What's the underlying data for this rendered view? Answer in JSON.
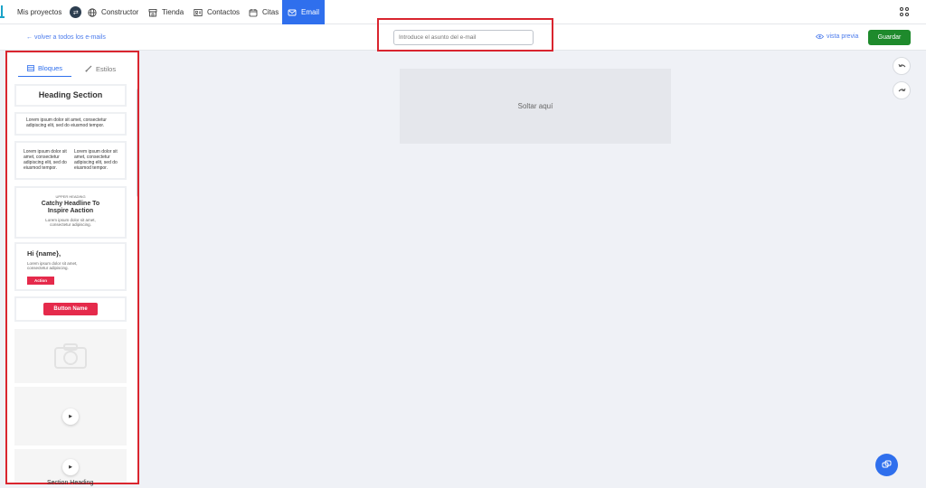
{
  "nav": {
    "projects_label": "Mis proyectos",
    "items": [
      {
        "label": "Constructor",
        "icon": "globe-icon"
      },
      {
        "label": "Tienda",
        "icon": "store-icon"
      },
      {
        "label": "Contactos",
        "icon": "contacts-icon"
      },
      {
        "label": "Citas",
        "icon": "calendar-icon"
      },
      {
        "label": "Email",
        "icon": "mail-icon",
        "active": true
      }
    ],
    "active_color": "#2f6fed"
  },
  "subbar": {
    "back_label": "← volver a todos los e-mails",
    "subject_placeholder": "Introduce el asunto del e-mail",
    "preview_label": "vista previa",
    "save_label": "Guardar"
  },
  "sidebar": {
    "tabs": [
      {
        "label": "Bloques",
        "active": true
      },
      {
        "label": "Estilos"
      }
    ],
    "blocks": {
      "heading": "Heading Section",
      "text": "Lorem ipsum dolor sit amet, consectetur adipiscing elit, sed do eiusmod tempor.",
      "col1": "Lorem ipsum dolor sit amet, consectetur adipiscing elit, sed do eiusmod tempor.",
      "col2": "Lorem ipsum dolor sit amet, consectetur adipiscing elit, sed do eiusmod tempor.",
      "hero_upper": "UPPER HEADING",
      "hero_head": "Catchy Headline To Inspire Aaction",
      "hero_desc": "Lorem ipsum dolor sit amet, consectetur adipiscing.",
      "greet_hi": "Hi {name},",
      "greet_desc": "Lorem ipsum dolor sit amet, consectetur adipiscing.",
      "greet_action": "Action",
      "button_label": "Button Name",
      "section_heading": "Section Heading"
    }
  },
  "canvas": {
    "dropzone_label": "Soltar aquí"
  },
  "colors": {
    "save_green": "#1e8a2c",
    "highlight_red": "#d9252f",
    "cta_pink": "#e52a4b"
  }
}
